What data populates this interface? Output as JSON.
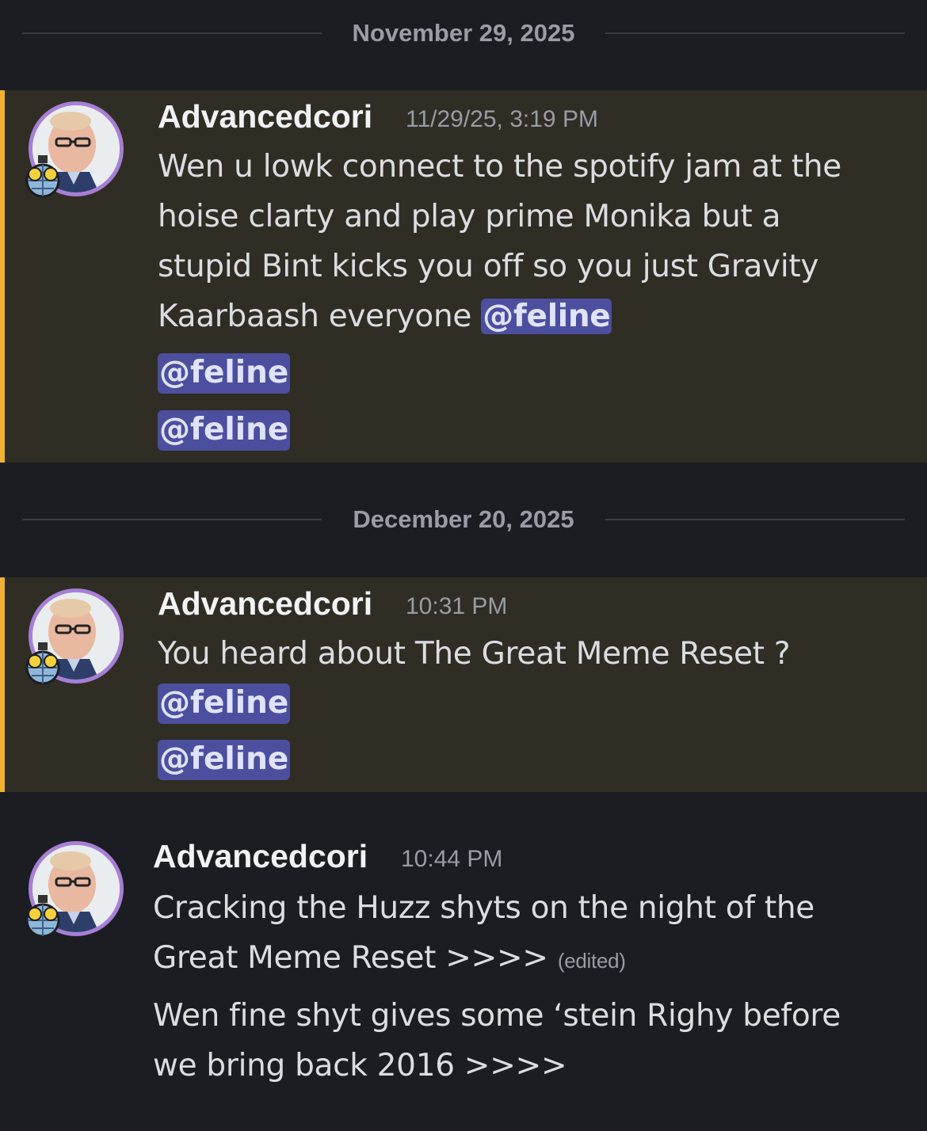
{
  "dividers": [
    {
      "date": "November 29, 2025"
    },
    {
      "date": "December 20, 2025"
    }
  ],
  "messages": [
    {
      "author": "Advancedcori",
      "timestamp": "11/29/25, 3:19 PM",
      "lines": [
        "Wen u lowk connect to the spotify jam at the",
        "hoise clarty and play prime Monika but a",
        "stupid Bint kicks you off so you just Gravity",
        "Kaarbaash everyone"
      ],
      "inline_mention": "@feline",
      "mentions": [
        "@feline",
        "@feline"
      ],
      "highlighted": true
    },
    {
      "author": "Advancedcori",
      "timestamp": "10:31 PM",
      "lines": [
        "You heard about The Great Meme Reset ?"
      ],
      "mentions": [
        "@feline",
        "@feline"
      ],
      "highlighted": true
    },
    {
      "author": "Advancedcori",
      "timestamp": "10:44 PM",
      "lines": [
        "Cracking the Huzz shyts on the night of the",
        "Great Meme Reset >>>>"
      ],
      "edited_label": "(edited)",
      "followup_lines": [
        "Wen fine shyt gives some ‘stein Righy before",
        "we bring back 2016 >>>>"
      ],
      "highlighted": false
    }
  ],
  "colors": {
    "background": "#1c1d22",
    "highlight_bg": "#302d25",
    "highlight_bar": "#f0b232",
    "mention_bg": "#4b4f9e",
    "avatar_ring": "#a77fd6"
  },
  "icons": {
    "avatar": "avatar-photo",
    "decoration": "disco-ball-sunglasses-icon"
  }
}
